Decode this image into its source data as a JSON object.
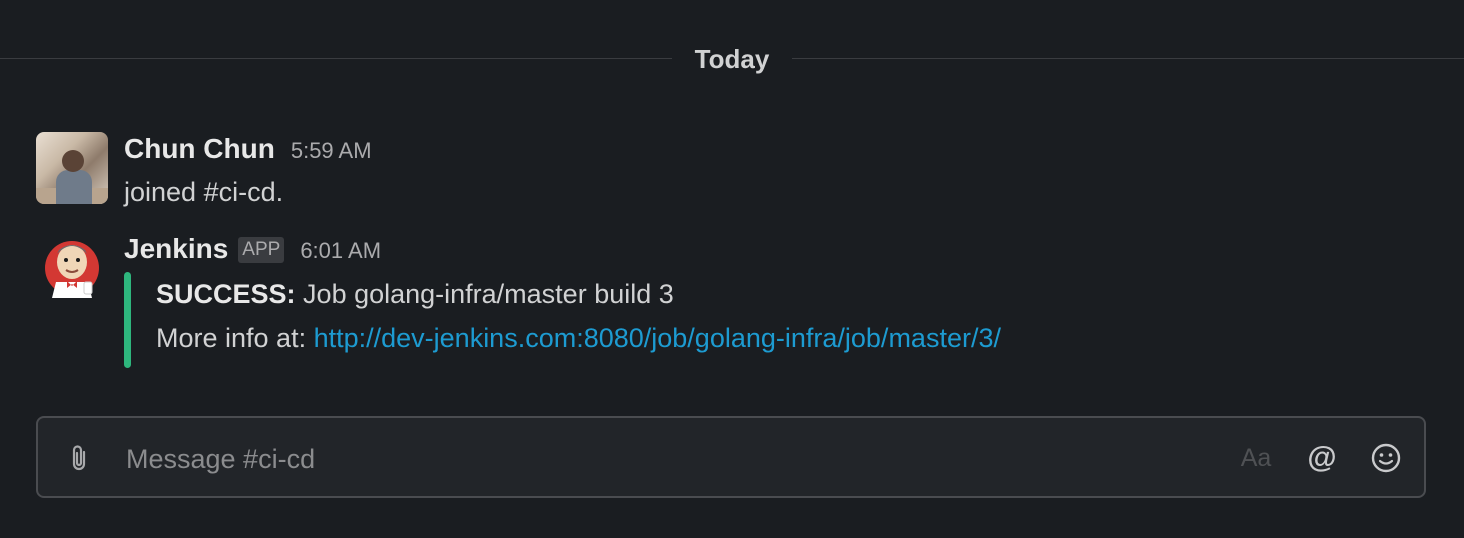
{
  "divider": {
    "label": "Today"
  },
  "messages": [
    {
      "sender": "Chun Chun",
      "time": "5:59 AM",
      "text": "joined #ci-cd."
    },
    {
      "sender": "Jenkins",
      "badge": "APP",
      "time": "6:01 AM",
      "attachment": {
        "status_label": "SUCCESS:",
        "status_text": "Job golang-infra/master build 3",
        "more_info_label": "More info at:",
        "link": "http://dev-jenkins.com:8080/job/golang-infra/job/master/3/",
        "bar_color": "#2eb67d"
      }
    }
  ],
  "composer": {
    "placeholder": "Message #ci-cd",
    "format_label": "Aa",
    "mention_label": "@",
    "icons": {
      "attach": "paperclip-icon",
      "emoji": "smiley-icon"
    }
  },
  "colors": {
    "background": "#1a1d21",
    "link": "#1d9bd1",
    "success": "#2eb67d"
  }
}
